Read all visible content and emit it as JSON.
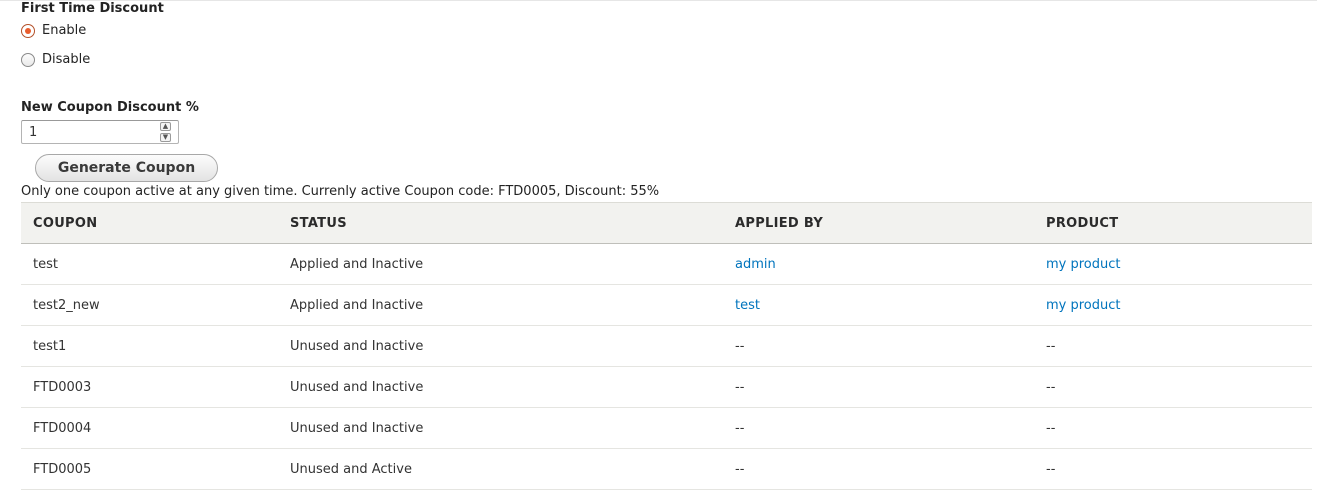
{
  "first_time_discount": {
    "title": "First Time Discount",
    "options": [
      {
        "label": "Enable",
        "selected": true
      },
      {
        "label": "Disable",
        "selected": false
      }
    ]
  },
  "new_coupon": {
    "label": "New Coupon Discount %",
    "value": "1",
    "up_icon": "chevron-up-icon",
    "down_icon": "chevron-down-icon"
  },
  "generate_button": {
    "label": "Generate Coupon"
  },
  "info_text": "Only one coupon active at any given time. Currenly active Coupon code: FTD0005, Discount: 55%",
  "table": {
    "headers": [
      "COUPON",
      "STATUS",
      "APPLIED BY",
      "PRODUCT"
    ],
    "rows": [
      {
        "coupon": "test",
        "status": "Applied and Inactive",
        "applied_by": "admin",
        "product": "my product"
      },
      {
        "coupon": "test2_new",
        "status": "Applied and Inactive",
        "applied_by": "test",
        "product": "my product"
      },
      {
        "coupon": "test1",
        "status": "Unused and Inactive",
        "applied_by": "--",
        "product": "--"
      },
      {
        "coupon": "FTD0003",
        "status": "Unused and Inactive",
        "applied_by": "--",
        "product": "--"
      },
      {
        "coupon": "FTD0004",
        "status": "Unused and Inactive",
        "applied_by": "--",
        "product": "--"
      },
      {
        "coupon": "FTD0005",
        "status": "Unused and Active",
        "applied_by": "--",
        "product": "--"
      }
    ]
  },
  "colors": {
    "link": "#0074bd",
    "radio_selected": "#e95c2c",
    "table_header_bg": "#f2f2ef"
  }
}
